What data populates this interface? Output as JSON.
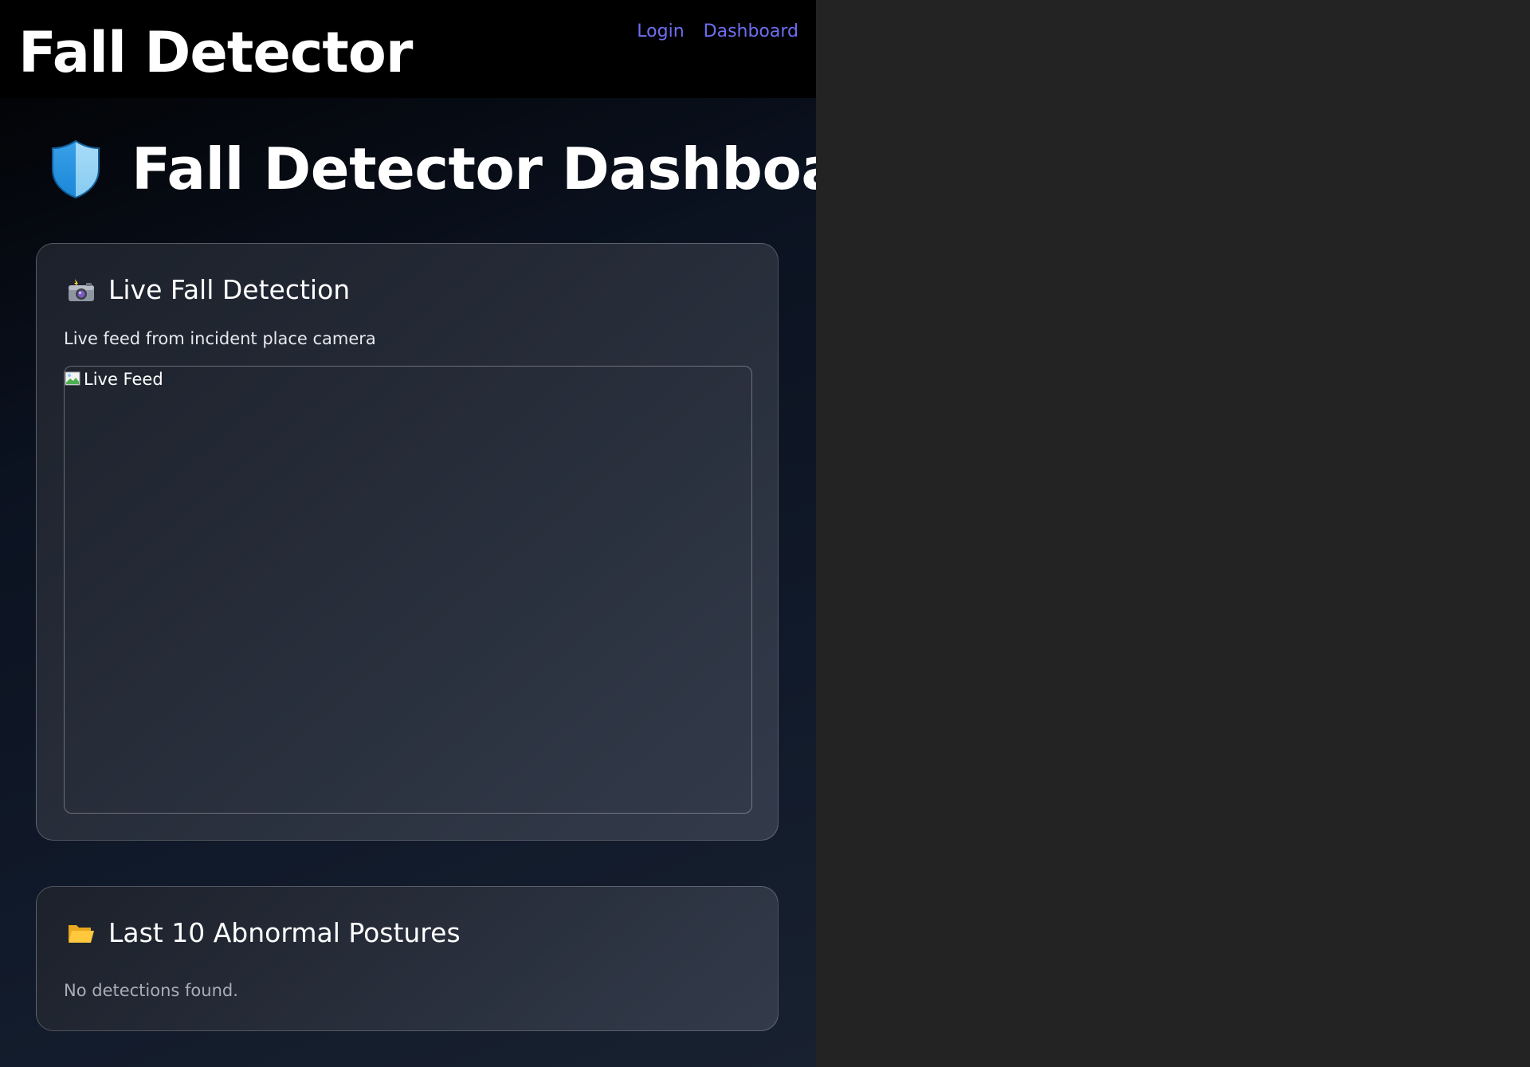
{
  "navbar": {
    "brand": "Fall Detector",
    "links": [
      "Login",
      "Dashboard"
    ]
  },
  "page": {
    "title": "Fall Detector Dashboard",
    "title_icon": "shield-icon"
  },
  "live_card": {
    "icon": "camera-with-flash-icon",
    "title": "Live Fall Detection",
    "subtitle": "Live feed from incident place camera",
    "feed_alt": "Live Feed"
  },
  "history_card": {
    "icon": "open-folder-icon",
    "title": "Last 10 Abnormal Postures",
    "empty_message": "No detections found."
  },
  "colors": {
    "link": "#6e6ef0",
    "page_background": "#232323",
    "navbar_background": "#000000"
  }
}
